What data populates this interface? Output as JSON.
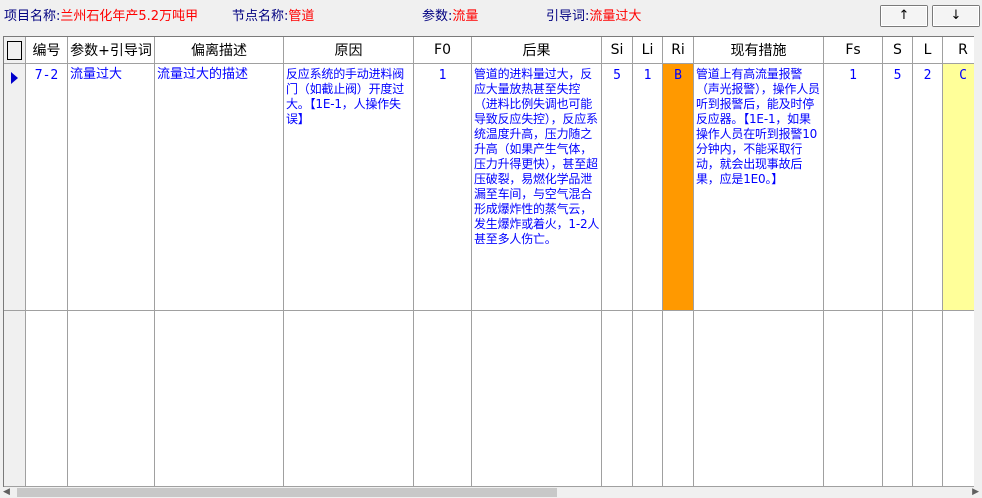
{
  "toolbar": {
    "project_label": "项目名称:",
    "project_value": "兰州石化年产5.2万吨甲",
    "node_label": "节点名称:",
    "node_value": "管道",
    "param_label": "参数:",
    "param_value": "流量",
    "guide_label": "引导词:",
    "guide_value": "流量过大",
    "up_label": "↑",
    "down_label": "↓"
  },
  "grid": {
    "headers": [
      "编号",
      "参数+引导词",
      "偏离描述",
      "原因",
      "F0",
      "后果",
      "Si",
      "Li",
      "Ri",
      "现有措施",
      "Fs",
      "S",
      "L",
      "R"
    ],
    "rows": [
      {
        "id": "7-2",
        "param_guide": "流量过大",
        "deviation": "流量过大的描述",
        "cause": "反应系统的手动进料阀门（如截止阀）开度过大。【1E-1，人操作失误】",
        "f0": "1",
        "consequence": "管道的进料量过大，反应大量放热甚至失控（进料比例失调也可能导致反应失控），反应系统温度升高，压力随之升高（如果产生气体，压力升得更快），甚至超压破裂，易燃化学品泄漏至车间，与空气混合形成爆炸性的蒸气云，发生爆炸或着火，1-2人甚至多人伤亡。",
        "si": "5",
        "li": "1",
        "ri": "B",
        "measures": "管道上有高流量报警（声光报警），操作人员听到报警后，能及时停反应器。【1E-1，如果操作人员在听到报警10分钟内，不能采取行动，就会出现事故后果，应是1E0。】",
        "fs": "1",
        "s": "5",
        "l": "2",
        "r": "C"
      }
    ]
  },
  "colors": {
    "label_blue": "#000080",
    "value_red": "#ff0000",
    "cell_text_blue": "#0000ff",
    "ri_orange": "#ff9900",
    "r_yellow": "#ffff99"
  }
}
